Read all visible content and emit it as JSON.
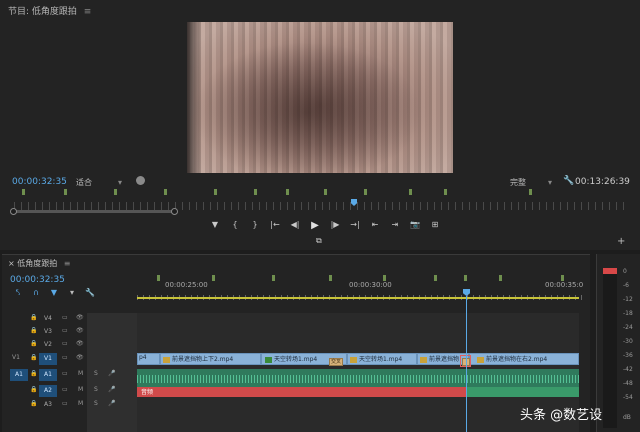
{
  "program_monitor": {
    "title": "节目: 低角度跟拍",
    "menu_icon": "≡",
    "timecode": "00:00:32:35",
    "fit_label": "适合",
    "resolution_label": "完整",
    "duration": "00:13:26:39",
    "dropdown_caret": "▾",
    "wrench_glyph": "🔧",
    "plus_glyph": "+",
    "controls": [
      "▼",
      "{",
      "}",
      "|←",
      "◀|",
      "▶",
      "|▶",
      "→|",
      "⇤",
      "⇥",
      "📷",
      "⊞"
    ],
    "export_glyph": "⧉"
  },
  "timeline": {
    "title": "低角度跟拍",
    "close_glyph": "×",
    "menu_icon": "≡",
    "timecode": "00:00:32:35",
    "tools": [
      "⤣",
      "∩",
      "▼",
      "▾",
      "🔧"
    ],
    "ruler_labels": [
      "00:00:25:00",
      "00:00:30:00",
      "00:00:35:0"
    ],
    "tracks": [
      {
        "lock": "🔒",
        "name": "V4",
        "film": "▭",
        "eye": "👁"
      },
      {
        "lock": "🔒",
        "name": "V3",
        "film": "▭",
        "eye": "👁"
      },
      {
        "lock": "🔒",
        "name": "V2",
        "film": "▭",
        "eye": "👁"
      },
      {
        "src": "V1",
        "lock": "🔒",
        "name": "V1",
        "film": "▭",
        "eye": "👁"
      },
      {
        "src": "A1",
        "lock": "🔒",
        "name": "A1",
        "film": "▭",
        "m": "M",
        "s": "S",
        "mic": "🎤"
      },
      {
        "lock": "🔒",
        "name": "A2",
        "film": "▭",
        "m": "M",
        "s": "S",
        "mic": "🎤"
      },
      {
        "lock": "🔒",
        "name": "A3",
        "film": "▭",
        "m": "M",
        "s": "S",
        "mic": "🎤"
      }
    ],
    "clips": [
      {
        "label": "p4"
      },
      {
        "label": "前景遮挡物上下2.mp4"
      },
      {
        "label": "天空转场1.mp4"
      },
      {
        "label": "天空转场1.mp4"
      },
      {
        "label": "前景遮挡物"
      },
      {
        "label": "前景遮挡物在右2.mp4"
      }
    ],
    "transition_label": "交叉",
    "audio_label": "音频"
  },
  "audio_meter": {
    "labels": [
      "0",
      "-6",
      "-12",
      "-18",
      "-24",
      "-30",
      "-36",
      "-42",
      "-48",
      "-54",
      "dB"
    ]
  },
  "watermark": "头条 @数艺设"
}
